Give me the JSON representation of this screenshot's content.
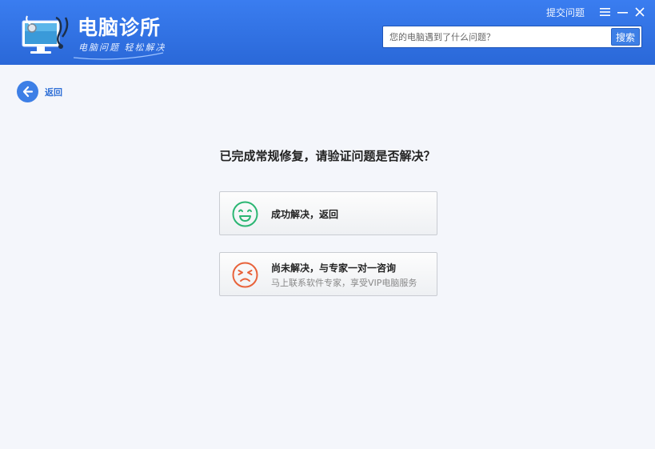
{
  "app": {
    "title": "电脑诊所",
    "slogan": "电脑问题 轻松解决"
  },
  "topbar": {
    "submit_label": "提交问题"
  },
  "search": {
    "placeholder": "您的电脑遇到了什么问题？",
    "button_label": "搜索"
  },
  "nav": {
    "back_label": "返回"
  },
  "main": {
    "question": "已完成常规修复，请验证问题是否解决？",
    "options": [
      {
        "title": "成功解决，返回",
        "icon": "smile-icon",
        "color": "#2bb673"
      },
      {
        "title": "尚未解决，与专家一对一咨询",
        "subtitle": "马上联系软件专家，享受VIP电脑服务",
        "icon": "sad-icon",
        "color": "#e8623a"
      }
    ]
  },
  "colors": {
    "header": "#2b6fe0",
    "accent": "#3d7fe6",
    "background": "#f4f6fb"
  }
}
